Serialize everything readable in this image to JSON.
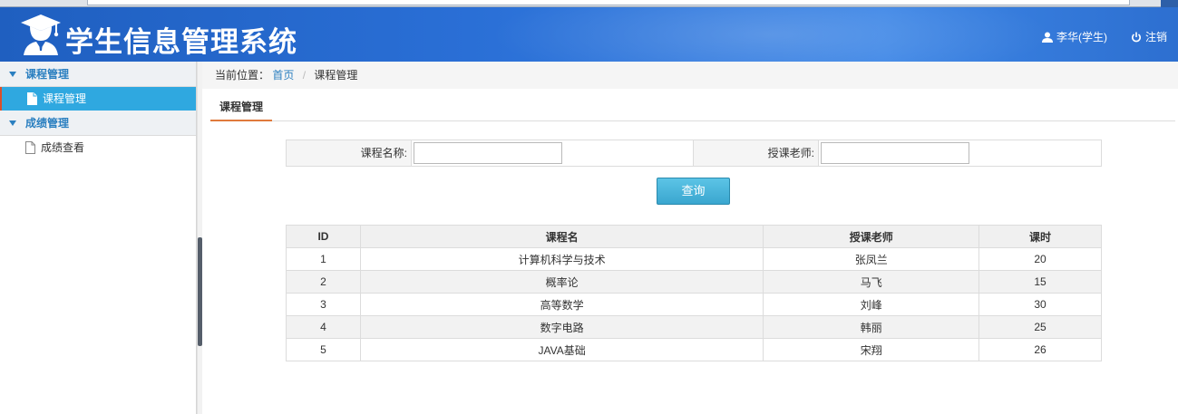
{
  "header": {
    "title": "学生信息管理系统",
    "user_label": "李华(学生)",
    "logout_label": "注销"
  },
  "sidebar": {
    "groups": [
      {
        "label": "课程管理",
        "items": [
          {
            "label": "课程管理",
            "active": true
          }
        ]
      },
      {
        "label": "成绩管理",
        "items": [
          {
            "label": "成绩查看",
            "active": false
          }
        ]
      }
    ]
  },
  "breadcrumb": {
    "prefix": "当前位置：",
    "home": "首页",
    "current": "课程管理"
  },
  "tabs": [
    {
      "label": "课程管理"
    }
  ],
  "search": {
    "course_name_label": "课程名称:",
    "course_name_value": "",
    "teacher_label": "授课老师:",
    "teacher_value": "",
    "query_button": "查询"
  },
  "table": {
    "headers": [
      "ID",
      "课程名",
      "授课老师",
      "课时"
    ],
    "rows": [
      [
        "1",
        "计算机科学与技术",
        "张凤兰",
        "20"
      ],
      [
        "2",
        "概率论",
        "马飞",
        "15"
      ],
      [
        "3",
        "高等数学",
        "刘峰",
        "30"
      ],
      [
        "4",
        "数字电路",
        "韩丽",
        "25"
      ],
      [
        "5",
        "JAVA基础",
        "宋翔",
        "26"
      ]
    ]
  },
  "colors": {
    "header_blue": "#2a6fd6",
    "active_item": "#2fa8e0",
    "link_blue": "#2a7fc0",
    "tab_underline": "#e07a3c"
  }
}
